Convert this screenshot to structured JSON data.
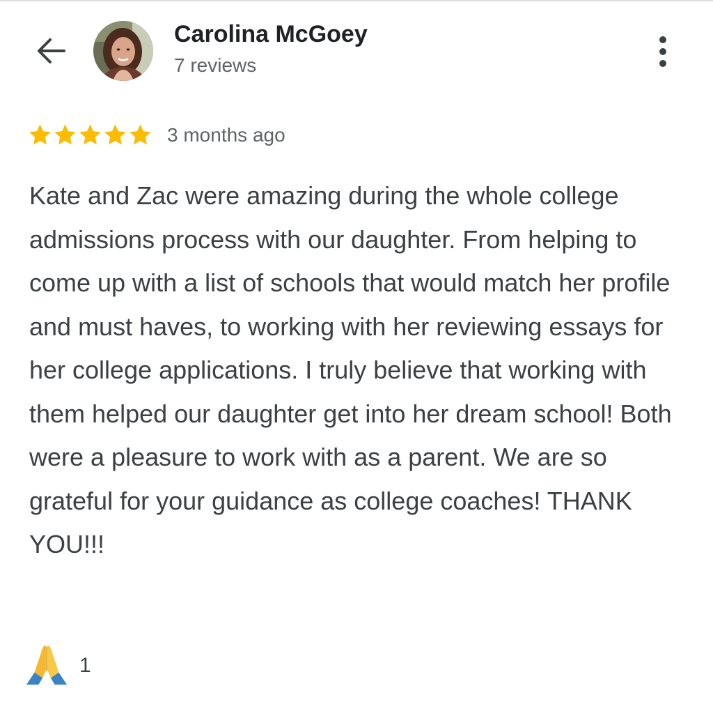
{
  "header": {
    "back_icon": "arrow-left-icon",
    "reviewer_name": "Carolina McGoey",
    "review_count": "7 reviews",
    "menu_icon": "more-vert-icon"
  },
  "review": {
    "rating": 5,
    "rating_max": 5,
    "star_color": "#fbbc04",
    "time": "3 months ago",
    "text": "Kate and Zac were amazing during the whole college admissions process with our daughter. From helping to come up with a list of schools that would match her profile and must haves, to working with her reviewing essays for her college applications. I truly believe that working with them helped our daughter get into her dream school! Both were a pleasure to work with as a parent. We are so grateful for your guidance as college coaches! THANK YOU!!!"
  },
  "reaction": {
    "icon": "folded-hands-emoji-icon",
    "count": "1"
  }
}
